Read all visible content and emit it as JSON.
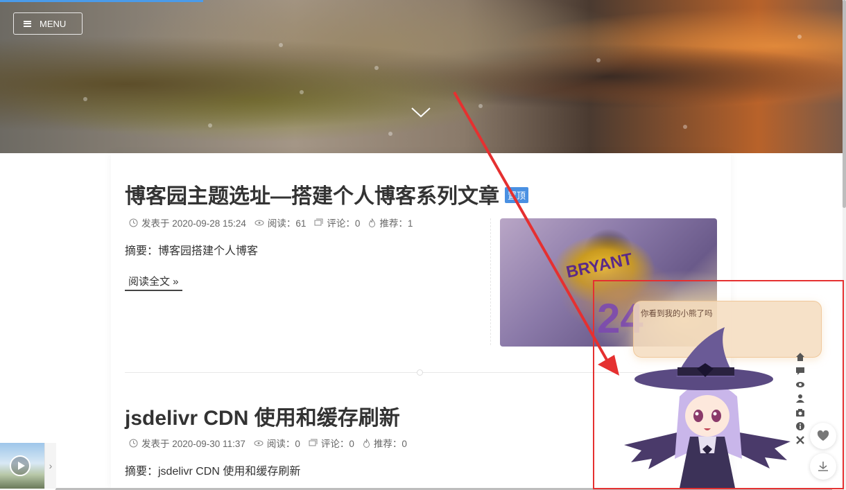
{
  "header": {
    "menu_label": "MENU",
    "reading_progress": 0.24
  },
  "posts": [
    {
      "title": "博客园主题选址—搭建个人博客系列文章",
      "badge": "置顶",
      "published": "发表于 2020-09-28 15:24",
      "reads": "阅读：61",
      "comments": "评论：0",
      "recommends": "推荐：1",
      "summary": "摘要：博客园搭建个人博客",
      "readmore": "阅读全文 »",
      "thumbnail": {
        "jersey_text": "BRYANT",
        "number": "24"
      }
    },
    {
      "title": "jsdelivr CDN 使用和缓存刷新",
      "published": "发表于 2020-09-30 11:37",
      "reads": "阅读：0",
      "comments": "评论：0",
      "recommends": "推荐：0",
      "summary": "摘要：jsdelivr CDN 使用和缓存刷新"
    }
  ],
  "widget": {
    "speech": "你看到我的小熊了吗",
    "tools": [
      "home-icon",
      "comment-icon",
      "eye-icon",
      "user-icon",
      "camera-icon",
      "info-icon",
      "close-icon"
    ]
  },
  "float_buttons": [
    "heart-icon",
    "download-icon"
  ],
  "colors": {
    "accent": "#4a90e2",
    "annotation": "#e53030",
    "speech_bg": "#f5dcbe"
  }
}
